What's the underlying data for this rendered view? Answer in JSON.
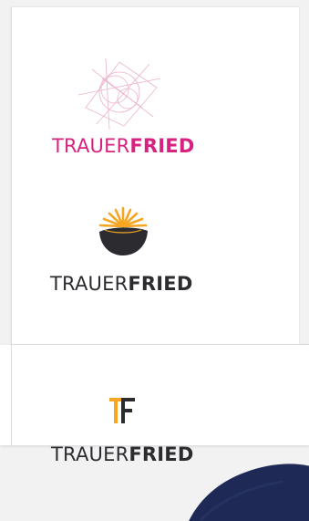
{
  "logos": [
    {
      "name": "trauerfried-pink",
      "word_light": "TRAUER",
      "word_bold": "FRIED",
      "color": "#d7237f"
    },
    {
      "name": "trauerfried-sun",
      "word_light": "TRAUER",
      "word_bold": "FRIED",
      "color": "#2c2c30",
      "accent": "#f6a623"
    },
    {
      "name": "trauerfried-tf",
      "word_light": "TRAUER",
      "word_bold": "FRIED",
      "color": "#2c2c30",
      "accent": "#f6a623"
    }
  ],
  "icons": {
    "geometric_mark": "geometric-circle-icon",
    "sun_mark": "sunrise-bowl-icon",
    "tf_mark": "tf-monogram-icon"
  },
  "colors": {
    "pink": "#d7237f",
    "dark": "#2c2c30",
    "orange": "#f6a623",
    "navy": "#1e2a55",
    "background": "#f2f2f3"
  }
}
